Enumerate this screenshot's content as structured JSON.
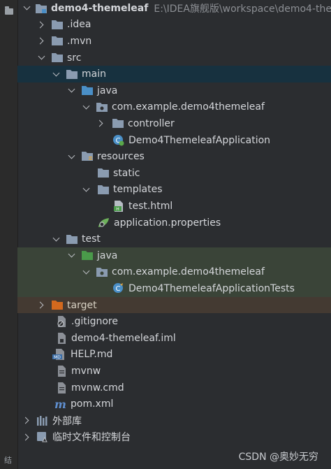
{
  "colors": {
    "background": "#2b2d30",
    "selected_row": "#17313f",
    "test_row": "#3a4438",
    "excluded_row": "#443a32",
    "folder": "#8a9bb0",
    "source_folder": "#4a8fc7",
    "test_folder": "#4a9a4a",
    "excluded_folder": "#d2691e"
  },
  "tree": {
    "project": {
      "name": "demo4-themeleaf",
      "path": "E:\\IDEA旗舰版\\workspace\\demo4-the",
      "icon": "module-folder-icon"
    },
    "idea": {
      "label": ".idea",
      "icon": "folder-icon"
    },
    "mvn": {
      "label": ".mvn",
      "icon": "folder-icon"
    },
    "src": {
      "label": "src",
      "icon": "folder-icon"
    },
    "main": {
      "label": "main",
      "icon": "folder-icon"
    },
    "main_java": {
      "label": "java",
      "icon": "source-folder-icon"
    },
    "main_pkg": {
      "label": "com.example.demo4themeleaf",
      "icon": "package-icon"
    },
    "controller": {
      "label": "controller",
      "icon": "folder-icon"
    },
    "app_class": {
      "label": "Demo4ThemeleafApplication",
      "icon": "spring-boot-class-icon"
    },
    "resources": {
      "label": "resources",
      "icon": "resources-folder-icon"
    },
    "static": {
      "label": "static",
      "icon": "folder-icon"
    },
    "templates": {
      "label": "templates",
      "icon": "folder-icon"
    },
    "test_html": {
      "label": "test.html",
      "icon": "html-file-icon"
    },
    "app_props": {
      "label": "application.properties",
      "icon": "spring-properties-icon"
    },
    "test": {
      "label": "test",
      "icon": "folder-icon"
    },
    "test_java": {
      "label": "java",
      "icon": "test-source-folder-icon"
    },
    "test_pkg": {
      "label": "com.example.demo4themeleaf",
      "icon": "package-icon"
    },
    "test_class": {
      "label": "Demo4ThemeleafApplicationTests",
      "icon": "test-class-icon"
    },
    "target": {
      "label": "target",
      "icon": "excluded-folder-icon"
    },
    "gitignore": {
      "label": ".gitignore",
      "icon": "ignored-file-icon"
    },
    "iml": {
      "label": "demo4-themeleaf.iml",
      "icon": "iml-file-icon"
    },
    "help": {
      "label": "HELP.md",
      "icon": "markdown-file-icon"
    },
    "mvnw": {
      "label": "mvnw",
      "icon": "text-file-icon"
    },
    "mvnw_cmd": {
      "label": "mvnw.cmd",
      "icon": "text-file-icon"
    },
    "pom": {
      "label": "pom.xml",
      "icon": "maven-icon"
    },
    "ext_libs": {
      "label": "外部库",
      "icon": "libraries-icon"
    },
    "scratches": {
      "label": "临时文件和控制台",
      "icon": "scratches-icon"
    }
  },
  "side_strip": {
    "label": "结"
  },
  "watermark": "CSDN @奥妙无穷"
}
